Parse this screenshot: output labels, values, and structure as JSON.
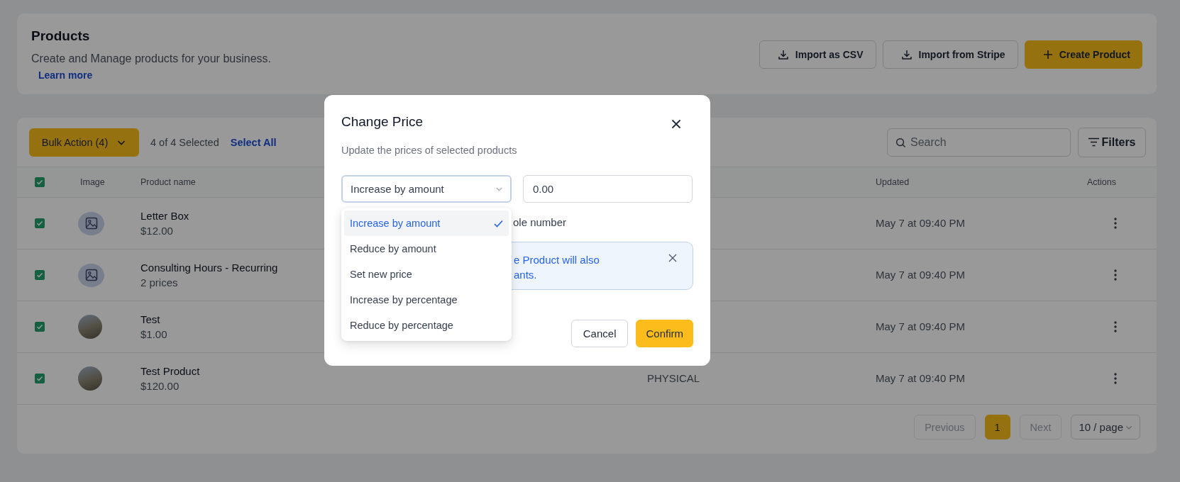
{
  "header": {
    "title": "Products",
    "subtitle": "Create and Manage products for your business.",
    "link": "Learn more",
    "buttons": [
      {
        "label": "Import as CSV",
        "kind": "import"
      },
      {
        "label": "Import from Stripe",
        "kind": "import"
      },
      {
        "label": "Create Product",
        "kind": "create"
      }
    ]
  },
  "toolbar": {
    "bulk_action": "Bulk Action (4)",
    "selection": "4 of 4 Selected",
    "select_all": "Select All",
    "search": {
      "placeholder": "Search"
    },
    "filters": "Filters"
  },
  "table": {
    "all_checked": true,
    "columns": [
      "Image",
      "Product name",
      "Updated",
      "Actions"
    ],
    "rows": [
      {
        "checked": true,
        "kind": "placeholder",
        "name": "Letter Box",
        "detail": "$12.00",
        "updated": "May 7 at 09:40 PM"
      },
      {
        "checked": true,
        "kind": "placeholder",
        "name": "Consulting Hours - Recurring",
        "detail": "2 prices",
        "updated": "May 7 at 09:40 PM"
      },
      {
        "checked": true,
        "kind": "photo",
        "name": "Test",
        "detail": "$1.00",
        "updated": "May 7 at 09:40 PM"
      },
      {
        "checked": true,
        "kind": "photo",
        "name": "Test Product",
        "detail": "$120.00",
        "column_3": "PHYSICAL",
        "updated": "May 7 at 09:40 PM"
      }
    ]
  },
  "pagination": {
    "previous": "Previous",
    "pages": [
      {
        "label": "1",
        "selected": true
      }
    ],
    "next": "Next",
    "page_size": "10 / page"
  },
  "modal": {
    "title": "Change Price",
    "subtitle": "Update the prices of selected products",
    "select": {
      "value": "Increase by amount",
      "options": [
        {
          "label": "Increase by amount",
          "selected": true
        },
        {
          "label": "Reduce by amount",
          "selected": false
        },
        {
          "label": "Set new price",
          "selected": false
        },
        {
          "label": "Increase by percentage",
          "selected": false
        },
        {
          "label": "Reduce by percentage",
          "selected": false
        }
      ]
    },
    "amount": {
      "value": "0.00"
    },
    "checkbox_label": "ole number",
    "alert": {
      "lines": [
        "e Product will also",
        "ants."
      ]
    },
    "buttons": [
      {
        "label": "Cancel",
        "kind": "secondary"
      },
      {
        "label": "Confirm",
        "kind": "primary"
      }
    ]
  }
}
